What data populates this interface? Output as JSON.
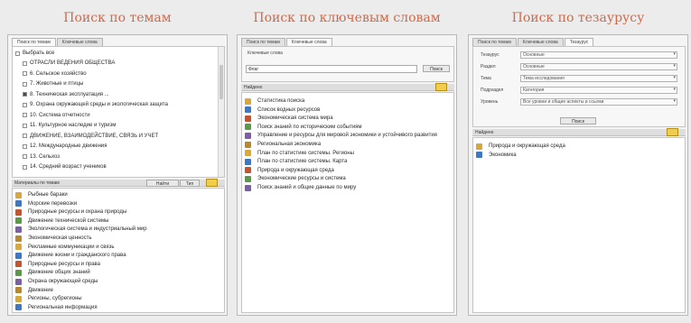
{
  "headings": {
    "themes": "Поиск по темам",
    "keywords": "Поиск по ключевым словам",
    "thesaurus": "Поиск по тезаурусу"
  },
  "colors": {
    "heading": "#d06a4a",
    "accent_button": "#f0cd4a",
    "icon_palette": [
      "#d9a83b",
      "#3f78c2",
      "#c3542e",
      "#5a9a46",
      "#7d5fa8",
      "#b8882c"
    ]
  },
  "themes_panel": {
    "tabs": [
      "Поиск по темам",
      "Ключевые слова"
    ],
    "select_all": "Выбрать все",
    "tree": [
      {
        "label": "ОТРАСЛИ ВЕДЕНИЯ ОБЩЕСТВА",
        "checked": false
      },
      {
        "label": "6. Сельское хозяйство",
        "checked": false
      },
      {
        "label": "7. Животные и птицы",
        "checked": false
      },
      {
        "label": "8. Техническая эксплуатация ...",
        "checked": true
      },
      {
        "label": "9. Охрана окружающей среды и экологическая защита",
        "checked": false
      },
      {
        "label": "10. Система отчетности",
        "checked": false
      },
      {
        "label": "11. Культурное наследие и туризм",
        "checked": false
      },
      {
        "label": "ДВИЖЕНИЕ, ВЗАИМОДЕЙСТВИЕ, СВЯЗЬ И УЧЕТ",
        "checked": false
      },
      {
        "label": "12. Международные движения",
        "checked": false
      },
      {
        "label": "13. Сельхоз",
        "checked": false
      },
      {
        "label": "14. Средний возраст учеников",
        "checked": false
      }
    ],
    "results_bar": "Материалы по темам",
    "btn_find": "Найти",
    "btn_reset": "Тип",
    "results": [
      "Рыбные бараки",
      "Морские перевозки",
      "Природные ресурсы и охрана природы",
      "Движение технической системы",
      "Экологическая система и индустриальный мир",
      "Экономическая ценность",
      "Рекламные коммуникации и связь",
      "Движение жизни и гражданского права",
      "Природные ресурсы и права",
      "Движение общих знаний",
      "Охрана окружающей среды",
      "Движение",
      "Регионы, субрегионы",
      "Региональная информация"
    ]
  },
  "keywords_panel": {
    "tabs": [
      "Поиск по темам",
      "Ключевые слова"
    ],
    "field_label": "Ключевые слова",
    "field_value": "Флаг",
    "btn_search": "Поиск",
    "results_bar": "Найдено",
    "results": [
      "Статистика поиска",
      "Список водных ресурсов",
      "Экономическая система мира",
      "Поиск знаний по историческим событиям",
      "Управление и ресурсы для мировой экономики и устойчивого развития",
      "Региональная экономика",
      "План по статистике системы. Регионы",
      "План по статистике системы. Карта",
      "Природа и окружающая среда",
      "Экономические ресурсы и система",
      "Поиск знаний и общие данные по миру"
    ]
  },
  "thesaurus_panel": {
    "tabs": [
      "Поиск по темам",
      "Ключевые слова",
      "Тезаурус"
    ],
    "fields": [
      {
        "label": "Тезаурус",
        "value": "Основные"
      },
      {
        "label": "Раздел",
        "value": "Основные"
      },
      {
        "label": "Тема",
        "value": "Тема исследования"
      },
      {
        "label": "Подраздел",
        "value": "Категория"
      },
      {
        "label": "Уровень",
        "value": "Все уровни и общие аспекты и ссылки"
      }
    ],
    "btn_search": "Поиск",
    "results_bar": "Найдено",
    "results": [
      "Природа и окружающая среда",
      "Экономика"
    ]
  }
}
